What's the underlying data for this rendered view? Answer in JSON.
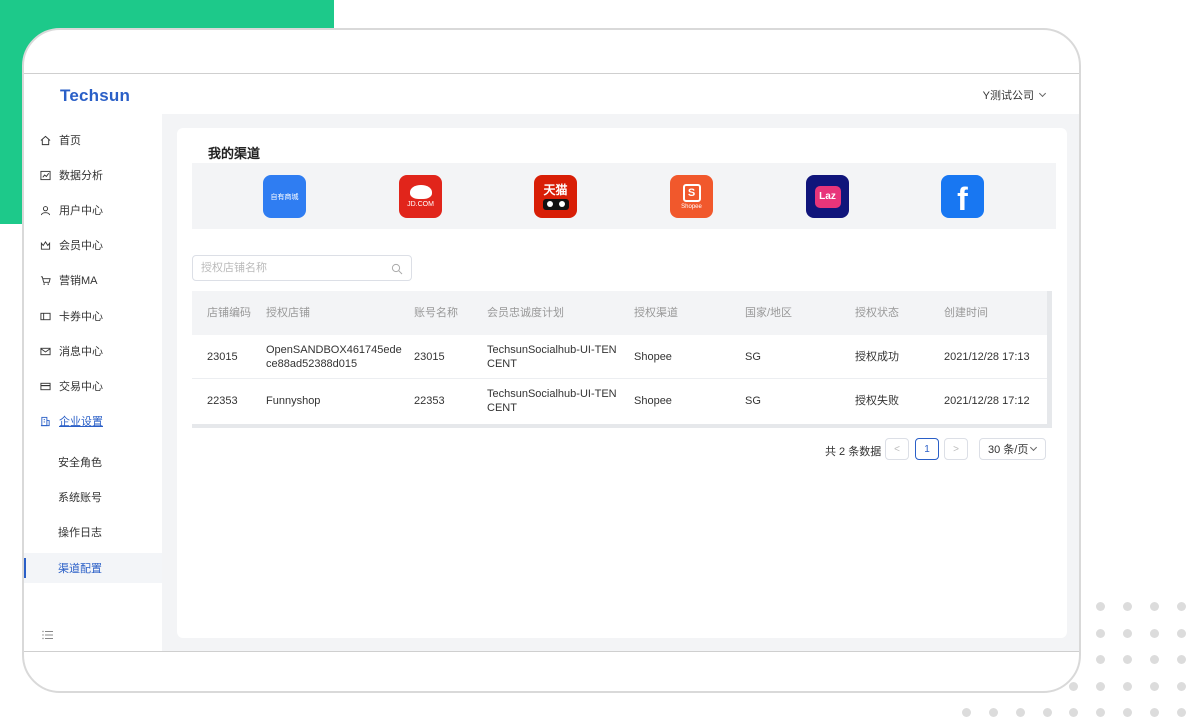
{
  "header": {
    "logo": "Techsun",
    "company": "Y测试公司"
  },
  "sidebar": {
    "items": [
      {
        "label": "首页",
        "icon": "home-icon"
      },
      {
        "label": "数据分析",
        "icon": "chart-icon"
      },
      {
        "label": "用户中心",
        "icon": "user-icon"
      },
      {
        "label": "会员中心",
        "icon": "crown-icon"
      },
      {
        "label": "营销MA",
        "icon": "cart-icon"
      },
      {
        "label": "卡券中心",
        "icon": "ticket-icon"
      },
      {
        "label": "消息中心",
        "icon": "mail-icon"
      },
      {
        "label": "交易中心",
        "icon": "card-icon"
      },
      {
        "label": "企业设置",
        "icon": "building-icon"
      }
    ],
    "sub_items": [
      {
        "label": "安全角色"
      },
      {
        "label": "系统账号"
      },
      {
        "label": "操作日志"
      },
      {
        "label": "渠道配置"
      }
    ]
  },
  "main": {
    "title": "我的渠道",
    "channels": [
      {
        "name": "own-store",
        "label": "自有商城",
        "color": "#2f7df2"
      },
      {
        "name": "jd",
        "label": "JD.COM",
        "color": "#e1251b"
      },
      {
        "name": "tmall",
        "label": "天猫",
        "color": "#d81e06"
      },
      {
        "name": "shopee",
        "label": "S",
        "sub": "Shopee",
        "color": "#f1582c"
      },
      {
        "name": "lazada",
        "label": "Laz",
        "color": "#10157b"
      },
      {
        "name": "facebook",
        "label": "f",
        "color": "#1877f2"
      }
    ],
    "search": {
      "placeholder": "授权店铺名称"
    },
    "table": {
      "columns": [
        "店铺编码",
        "授权店铺",
        "账号名称",
        "会员忠诚度计划",
        "授权渠道",
        "国家/地区",
        "授权状态",
        "创建时间"
      ],
      "rows": [
        [
          "23015",
          "OpenSANDBOX461745edece88ad52388d015",
          "23015",
          "TechsunSocialhub-UI-TENCENT",
          "Shopee",
          "SG",
          "授权成功",
          "2021/12/28 17:13"
        ],
        [
          "22353",
          "Funnyshop",
          "22353",
          "TechsunSocialhub-UI-TENCENT",
          "Shopee",
          "SG",
          "授权失败",
          "2021/12/28 17:12"
        ]
      ]
    },
    "pagination": {
      "total": "共 2 条数据",
      "prev": "<",
      "current": "1",
      "next": ">",
      "page_size": "30 条/页"
    }
  },
  "colors": {
    "brand": "#2a5fc7",
    "accent_green": "#1dc98a"
  }
}
